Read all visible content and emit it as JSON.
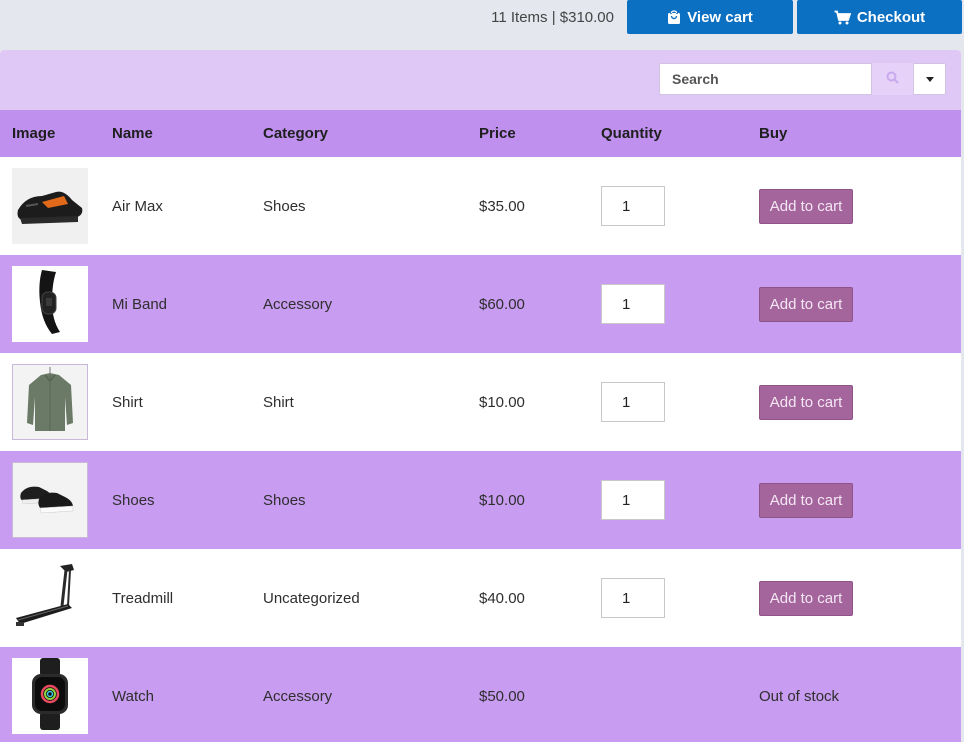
{
  "header": {
    "cart_summary": "11 Items | $310.00",
    "view_cart_label": "View cart",
    "checkout_label": "Checkout"
  },
  "toolbar": {
    "search_placeholder": "Search"
  },
  "table": {
    "columns": [
      "Image",
      "Name",
      "Category",
      "Price",
      "Quantity",
      "Buy"
    ],
    "rows": [
      {
        "name": "Air Max",
        "category": "Shoes",
        "price": "$35.00",
        "quantity": "1",
        "buy": "Add to cart",
        "image_icon": "sneaker-icon"
      },
      {
        "name": "Mi Band",
        "category": "Accessory",
        "price": "$60.00",
        "quantity": "1",
        "buy": "Add to cart",
        "image_icon": "fitness-band-icon"
      },
      {
        "name": "Shirt",
        "category": "Shirt",
        "price": "$10.00",
        "quantity": "1",
        "buy": "Add to cart",
        "image_icon": "shirt-icon"
      },
      {
        "name": "Shoes",
        "category": "Shoes",
        "price": "$10.00",
        "quantity": "1",
        "buy": "Add to cart",
        "image_icon": "shoes-icon"
      },
      {
        "name": "Treadmill",
        "category": "Uncategorized",
        "price": "$40.00",
        "quantity": "1",
        "buy": "Add to cart",
        "image_icon": "treadmill-icon"
      },
      {
        "name": "Watch",
        "category": "Accessory",
        "price": "$50.00",
        "quantity": "",
        "buy": "Out of stock",
        "image_icon": "smartwatch-icon"
      }
    ]
  },
  "colors": {
    "primary_button": "#0b6fc2",
    "toolbar_bg": "#e0c8f6",
    "header_row_bg": "#bf90ee",
    "striped_row_bg": "#c89cf0",
    "add_to_cart_bg": "#a4659d"
  }
}
